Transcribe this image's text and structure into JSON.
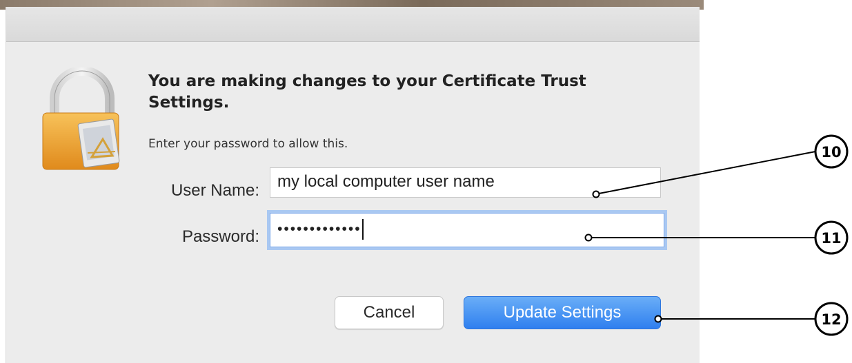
{
  "dialog": {
    "headline": "You are making changes to your Certificate Trust Settings.",
    "message": "Enter your password to allow this.",
    "icon": "lock-icon"
  },
  "form": {
    "username_label": "User Name:",
    "username_value": "my local computer user name",
    "password_label": "Password:",
    "password_value": "•••••••••••••"
  },
  "buttons": {
    "cancel": "Cancel",
    "update": "Update Settings"
  },
  "callouts": {
    "username": "10",
    "password": "11",
    "update": "12"
  },
  "colors": {
    "accent": "#2f7fef",
    "focus_ring": "#a9c8f2",
    "dialog_bg": "#ececec"
  }
}
